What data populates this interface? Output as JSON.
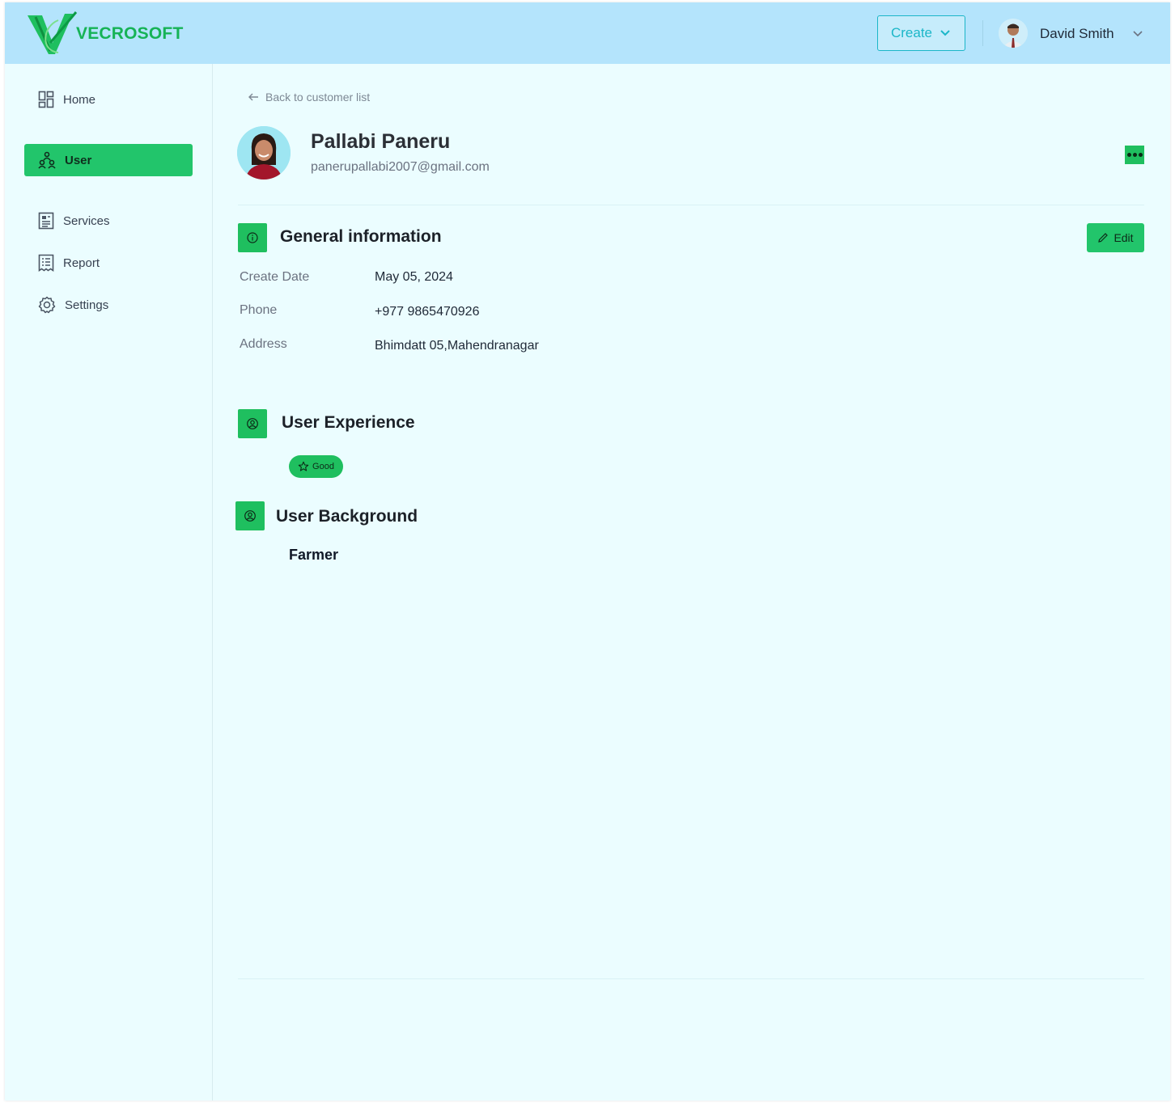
{
  "brand": {
    "name": "VECROSOFT"
  },
  "header": {
    "create_label": "Create",
    "user_name": "David Smith"
  },
  "sidebar": {
    "items": [
      {
        "label": "Home",
        "icon": "dashboard-icon"
      },
      {
        "label": "User",
        "icon": "users-icon",
        "active": true
      },
      {
        "label": "Services",
        "icon": "document-icon"
      },
      {
        "label": "Report",
        "icon": "receipt-icon"
      },
      {
        "label": "Settings",
        "icon": "gear-icon"
      }
    ]
  },
  "main": {
    "back_label": "Back to customer list",
    "profile": {
      "name": "Pallabi Paneru",
      "email": "panerupallabi2007@gmail.com"
    },
    "general": {
      "title": "General information",
      "edit_label": "Edit",
      "fields": [
        {
          "label": "Create Date",
          "value": "May 05, 2024"
        },
        {
          "label": "Phone",
          "value": "+977 9865470926"
        },
        {
          "label": "Address",
          "value": "Bhimdatt 05,Mahendranagar"
        }
      ]
    },
    "experience": {
      "title": "User Experience",
      "badge": "Good"
    },
    "background": {
      "title": "User Background",
      "value": "Farmer"
    }
  },
  "colors": {
    "accent": "#22c56b",
    "header_bg": "#b4e4fc",
    "page_bg": "#ebfdff",
    "create": "#1bb6c8"
  }
}
